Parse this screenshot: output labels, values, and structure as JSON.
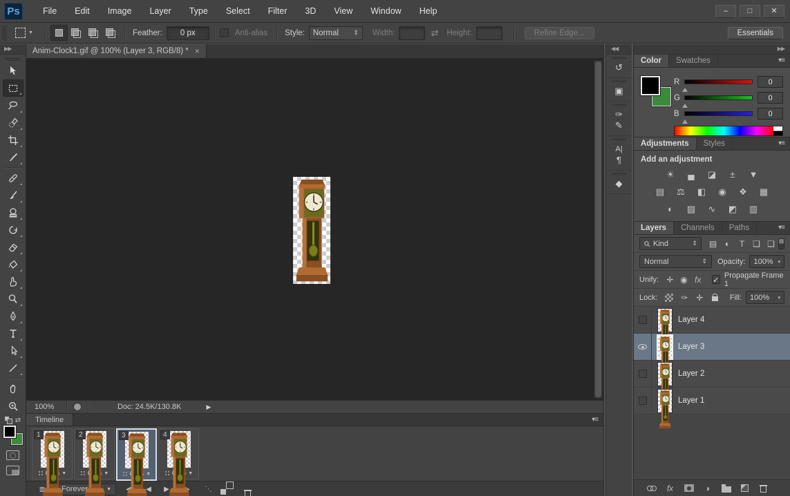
{
  "menubar": {
    "logo": "Ps",
    "items": [
      "File",
      "Edit",
      "Image",
      "Layer",
      "Type",
      "Select",
      "Filter",
      "3D",
      "View",
      "Window",
      "Help"
    ]
  },
  "window_controls": {
    "minimize": "–",
    "maximize": "□",
    "close": "✕"
  },
  "options_bar": {
    "feather_label": "Feather:",
    "feather_value": "0 px",
    "antialias_label": "Anti-alias",
    "style_label": "Style:",
    "style_value": "Normal",
    "width_label": "Width:",
    "height_label": "Height:",
    "swap_icon": "⇄",
    "refine_edge_label": "Refine Edge...",
    "workspace_label": "Essentials"
  },
  "document": {
    "tab_title": "Anim-Clock1.gif @ 100% (Layer 3, RGB/8) *",
    "close_glyph": "×"
  },
  "status_bar": {
    "zoom_level": "100%",
    "doc_info": "Doc: 24.5K/130.8K",
    "arrow": "▶"
  },
  "dock_arrows": {
    "collapse": "◀◀",
    "expand": "▶▶"
  },
  "dock_icons": {
    "history": "↺",
    "properties": "▣",
    "brush": "✑",
    "brush_presets": "✎",
    "character": "A|",
    "paragraph": "¶",
    "threed": "◆"
  },
  "color_panel": {
    "tab_color": "Color",
    "tab_swatches": "Swatches",
    "menu_icon": "▾≡",
    "channels": [
      {
        "label": "R",
        "value": "0"
      },
      {
        "label": "G",
        "value": "0"
      },
      {
        "label": "B",
        "value": "0"
      }
    ],
    "foreground_color": "#000000",
    "background_color": "#3c8a3c"
  },
  "adjustments_panel": {
    "tab_adjustments": "Adjustments",
    "tab_styles": "Styles",
    "menu_icon": "▾≡",
    "heading": "Add an adjustment",
    "row1": [
      "☀",
      "▄",
      "◪",
      "±",
      "▼"
    ],
    "row2": [
      "▤",
      "⚖",
      "◧",
      "◉",
      "❖",
      "▦"
    ],
    "row3": [
      "◐",
      "▨",
      "∿",
      "◩",
      "▥"
    ]
  },
  "layers_panel": {
    "tab_layers": "Layers",
    "tab_channels": "Channels",
    "tab_paths": "Paths",
    "menu_icon": "▾≡",
    "kind_label": "Kind",
    "spinner": "⇕",
    "filter_icons": [
      "▤",
      "◐",
      "T",
      "❑",
      "❏"
    ],
    "blend_mode": "Normal",
    "opacity_label": "Opacity:",
    "opacity_value": "100%",
    "caret": "▾",
    "unify_label": "Unify:",
    "unify_icons": [
      "✛",
      "◉",
      "fx"
    ],
    "propagate_checked": "✓",
    "propagate_label": "Propagate Frame 1",
    "lock_label": "Lock:",
    "lock_brush": "✑",
    "lock_move": "✛",
    "fill_label": "Fill:",
    "fill_value": "100%",
    "layers": [
      {
        "name": "Layer 4"
      },
      {
        "name": "Layer 3"
      },
      {
        "name": "Layer 2"
      },
      {
        "name": "Layer 1"
      }
    ],
    "selected_layer": "Layer 3",
    "footer_adjustment_icon": "◑"
  },
  "timeline": {
    "tab_label": "Timeline",
    "menu_icon": "▾≡",
    "convert_icon": "≣",
    "loop_value": "Forever",
    "loop_caret": "▼",
    "frame_caret": "▼",
    "frames": [
      {
        "number": "1",
        "delay": "0.25"
      },
      {
        "number": "2",
        "delay": "0.25"
      },
      {
        "number": "3",
        "delay": "0.25"
      },
      {
        "number": "4",
        "delay": "0.25"
      }
    ],
    "selected_frame": "3",
    "transport": {
      "rewind": "◀◀",
      "prev": "◀",
      "play": "▶",
      "next": "▶▶",
      "tween": "⋱"
    }
  },
  "colors": {
    "bar_bg": "#434343",
    "canvas_bg": "#262626",
    "panel_bg": "#4d4d4d",
    "selected_layer_bg": "#697787",
    "selected_frame_border": "#d7dfe8",
    "logo_blue": "#5aa7e8"
  }
}
